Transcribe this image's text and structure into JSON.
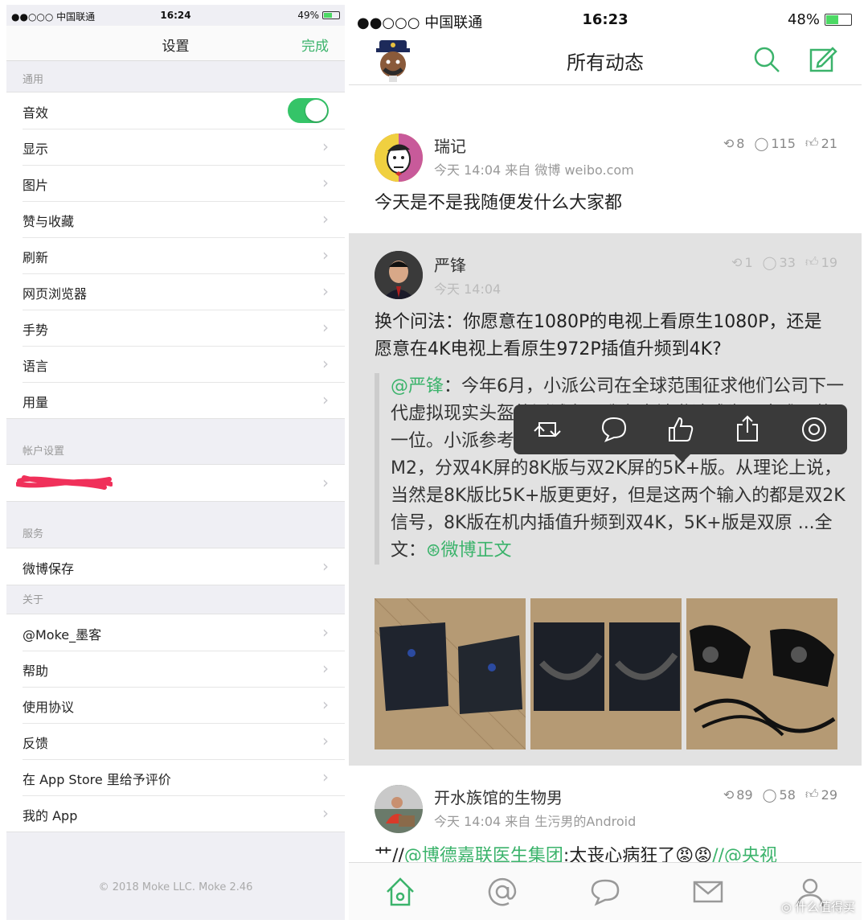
{
  "left": {
    "status": {
      "carrier": "●●○○○ 中国联通",
      "time": "16:24",
      "battery": "49%",
      "battery_level": 0.49
    },
    "nav": {
      "title": "设置",
      "done": "完成"
    },
    "sections": {
      "general": {
        "header": "通用",
        "items": [
          "音效",
          "显示",
          "图片",
          "赞与收藏",
          "刷新",
          "网页浏览器",
          "手势",
          "语言",
          "用量"
        ]
      },
      "account": {
        "header": "帐户设置"
      },
      "service": {
        "header": "服务",
        "items": [
          "微博保存"
        ]
      },
      "about": {
        "header": "关于",
        "items": [
          "@Moke_墨客",
          "帮助",
          "使用协议",
          "反馈",
          "在 App Store 里给予评价",
          "我的 App"
        ]
      }
    },
    "footer": "© 2018 Moke LLC. Moke 2.46"
  },
  "right": {
    "status": {
      "carrier": "●●○○○ 中国联通",
      "time": "16:23",
      "battery": "48%",
      "battery_level": 0.48
    },
    "nav": {
      "title": "所有动态"
    },
    "posts": [
      {
        "user": "瑞记",
        "meta": "今天 14:04 来自 微博 weibo.com",
        "reposts": "8",
        "comments": "115",
        "likes": "21",
        "text": "今天是不是我随便发什么大家都"
      },
      {
        "user": "严锋",
        "meta": "今天 14:04",
        "reposts": "1",
        "comments": "33",
        "likes": "19",
        "text": "换个问法：你愿意在1080P的电视上看原生1080P，还是愿意在4K电视上看原生972P插值升频到4K?",
        "quote_mention": "@严锋",
        "quote_text": "：今年6月，小派公司在全球范围征求他们公司下一代虚拟现实头盔的测试者，我有幸被邀请成为国内唯一的一位。小派参考了测试者的意见，最终推出了定型产品M2，分双4K屏的8K版与双2K屏的5K+版。从理论上说，当然是8K版比5K+版更更好，但是这两个输入的都是双2K信号，8K版在机内插值升频到双4K，5K+版是双原 ...全文：",
        "quote_link": "微博正文"
      },
      {
        "user": "开水族馆的生物男",
        "meta": "今天 14:04 来自 生污男的Android",
        "reposts": "89",
        "comments": "58",
        "likes": "29",
        "text_prefix": "艹//",
        "text_link1": "@博德嘉联医生集团",
        "text_mid": ":太丧心病狂了",
        "text_link2": "//@央视"
      }
    ],
    "watermark": "什么值得买"
  },
  "colors": {
    "accent": "#3bb36b",
    "toggle_on": "#35c468"
  }
}
